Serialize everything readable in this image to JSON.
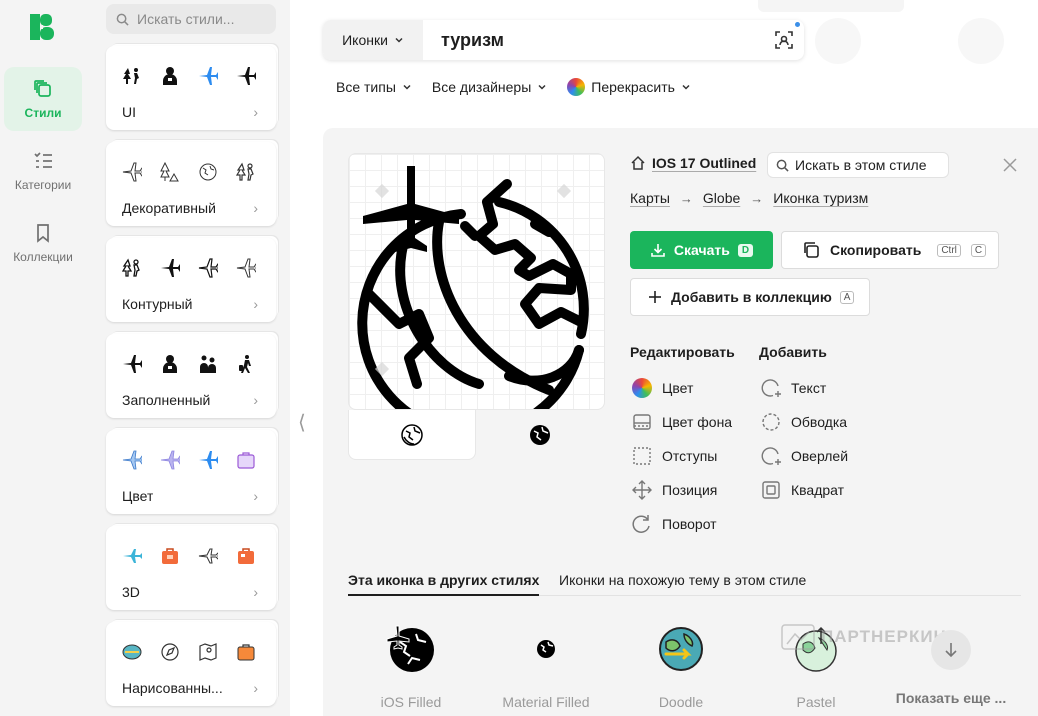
{
  "rail": {
    "items": [
      {
        "label": "Стили",
        "icon": "styles-icon",
        "active": true
      },
      {
        "label": "Категории",
        "icon": "categories-icon",
        "active": false
      },
      {
        "label": "Коллекции",
        "icon": "bookmark-icon",
        "active": false
      }
    ]
  },
  "styles_panel": {
    "search_placeholder": "Искать стили...",
    "cards": [
      {
        "name": "UI"
      },
      {
        "name": "Декоративный"
      },
      {
        "name": "Контурный"
      },
      {
        "name": "Заполненный"
      },
      {
        "name": "Цвет"
      },
      {
        "name": "3D"
      },
      {
        "name": "Нарисованны..."
      }
    ]
  },
  "search": {
    "type_label": "Иконки",
    "query": "туризм"
  },
  "filters": {
    "types": "Все типы",
    "designers": "Все дизайнеры",
    "recolor": "Перекрасить"
  },
  "detail": {
    "style_name": "IOS 17 Outlined",
    "search_in_style": "Искать в этом стиле",
    "breadcrumbs": [
      "Карты",
      "Globe",
      "Иконка туризм"
    ],
    "download": {
      "label": "Скачать",
      "key": "D"
    },
    "copy": {
      "label": "Скопировать",
      "key1": "Ctrl",
      "key2": "C"
    },
    "add_collection": {
      "label": "Добавить в коллекцию",
      "key": "A"
    },
    "edit": {
      "title": "Редактировать",
      "options": [
        "Цвет",
        "Цвет фона",
        "Отступы",
        "Позиция",
        "Поворот"
      ]
    },
    "add": {
      "title": "Добавить",
      "options": [
        "Текст",
        "Обводка",
        "Оверлей",
        "Квадрат"
      ]
    },
    "tabs": [
      "Эта иконка в других стилях",
      "Иконки на похожую тему в этом стиле"
    ],
    "other_styles": [
      "iOS Filled",
      "Material Filled",
      "Doodle",
      "Pastel"
    ],
    "show_more": "Показать еще ...",
    "watermark": "ПАРТНЕРКИН"
  },
  "colors": {
    "accent": "#1bb55c",
    "rail_bg": "#f4f4f4",
    "active_bg": "#e3f3e8",
    "panel_bg": "#f4f4f4"
  }
}
